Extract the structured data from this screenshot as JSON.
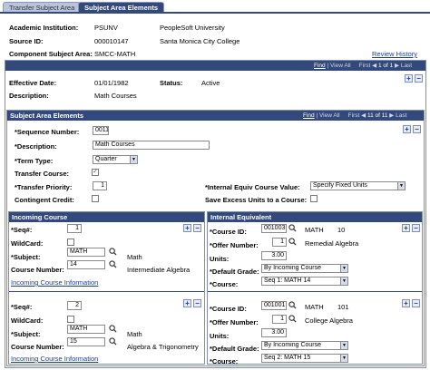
{
  "tabs": [
    {
      "label": "Transfer Subject Area"
    },
    {
      "label": "Subject Area Elements"
    }
  ],
  "header": {
    "academic_institution_label": "Academic Institution:",
    "academic_institution_code": "PSUNV",
    "academic_institution_name": "PeopleSoft University",
    "source_id_label": "Source ID:",
    "source_id_code": "000010147",
    "source_id_name": "Santa Monica City College",
    "component_subject_area_label": "Component Subject Area:",
    "component_subject_area_value": "SMCC-MATH",
    "review_history": "Review History"
  },
  "main_nav": {
    "find": "Find",
    "view_all": "View All",
    "first": "First",
    "range": "1 of 1",
    "last": "Last"
  },
  "effective": {
    "effective_date_label": "Effective Date:",
    "effective_date_value": "01/01/1982",
    "status_label": "Status:",
    "status_value": "Active",
    "description_label": "Description:",
    "description_value": "Math Courses"
  },
  "sae": {
    "title": "Subject Area Elements",
    "nav": {
      "find": "Find",
      "view_all": "View All",
      "first": "First",
      "range": "11 of 11",
      "last": "Last"
    },
    "seq_label": "*Sequence Number:",
    "seq_value": "0011",
    "description_label": "*Description:",
    "description_value": "Math Courses",
    "term_type_label": "*Term Type:",
    "term_type_value": "Quarter",
    "transfer_course_label": "Transfer Course:",
    "transfer_course_checked": true,
    "transfer_priority_label": "*Transfer Priority:",
    "transfer_priority_value": "1",
    "contingent_credit_label": "Contingent Credit:",
    "contingent_credit_checked": false,
    "internal_equiv_label": "*Internal Equiv Course Value:",
    "internal_equiv_value": "Specify Fixed Units",
    "save_excess_label": "Save Excess Units to a Course:",
    "save_excess_checked": false
  },
  "incoming": {
    "title": "Incoming Course",
    "rows": [
      {
        "seq_label": "*Seq#:",
        "seq": "1",
        "wildcard_label": "WildCard:",
        "subject_label": "*Subject:",
        "subject": "MATH",
        "subject_desc": "Math",
        "course_number_label": "Course Number:",
        "course_number": "14",
        "course_desc": "Intermediate Algebra",
        "link": "Incoming Course Information"
      },
      {
        "seq_label": "*Seq#:",
        "seq": "2",
        "wildcard_label": "WildCard:",
        "subject_label": "*Subject:",
        "subject": "MATH",
        "subject_desc": "Math",
        "course_number_label": "Course Number:",
        "course_number": "15",
        "course_desc": "Algebra & Trigonometry",
        "link": "Incoming Course Information"
      }
    ]
  },
  "internal": {
    "title": "Internal Equivalent",
    "rows": [
      {
        "course_id_label": "*Course ID:",
        "course_id": "001003",
        "subject": "MATH",
        "catalog": "10",
        "offer_label": "*Offer Number:",
        "offer": "1",
        "offer_desc": "Remedial Algebra",
        "units_label": "Units:",
        "units": "3.00",
        "grade_label": "*Default Grade:",
        "grade": "By Incoming Course",
        "course_label": "*Course:",
        "course": "Seq  1:  MATH 14"
      },
      {
        "course_id_label": "*Course ID:",
        "course_id": "001001",
        "subject": "MATH",
        "catalog": "101",
        "offer_label": "*Offer Number:",
        "offer": "1",
        "offer_desc": "College Algebra",
        "units_label": "Units:",
        "units": "3.00",
        "grade_label": "*Default Grade:",
        "grade": "By Incoming Course",
        "course_label": "*Course:",
        "course": "Seq  2:  MATH 15"
      }
    ]
  },
  "icons": {
    "lookup": "magnifier-icon",
    "add": "plus-icon",
    "remove": "minus-icon",
    "checkmark": "✓"
  },
  "colors": {
    "header_bg": "#33497c",
    "link": "#1a3c9a",
    "check": "#1a6b1a"
  }
}
